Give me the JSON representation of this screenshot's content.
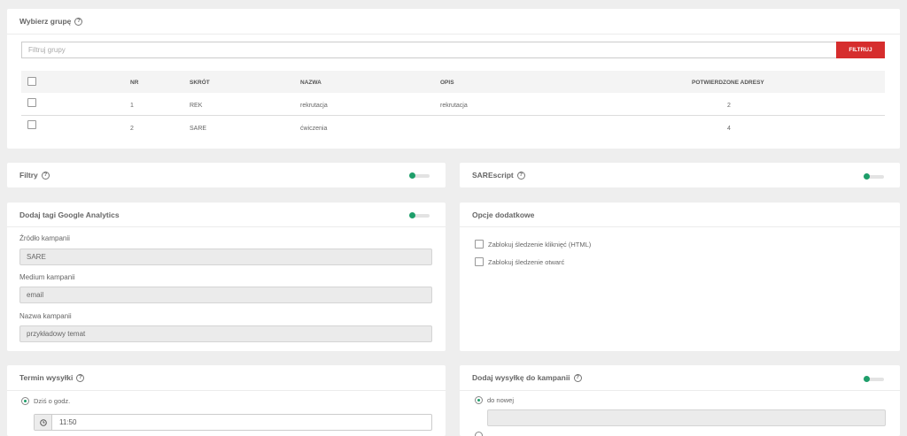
{
  "groups": {
    "title": "Wybierz grupę",
    "filter_placeholder": "Filtruj grupy",
    "filter_button": "FILTRUJ",
    "columns": [
      "NR",
      "SKRÓT",
      "NAZWA",
      "OPIS",
      "POTWIERDZONE ADRESY"
    ],
    "rows": [
      {
        "nr": "1",
        "skrot": "REK",
        "nazwa": "rekrutacja",
        "opis": "rekrutacja",
        "adresy": "2"
      },
      {
        "nr": "2",
        "skrot": "SARE",
        "nazwa": "ćwiczenia",
        "opis": "",
        "adresy": "4"
      }
    ]
  },
  "filters": {
    "title": "Filtry"
  },
  "sarescript": {
    "title": "SAREscript"
  },
  "ga": {
    "title": "Dodaj tagi Google Analytics",
    "source_label": "Źródło kampanii",
    "source_value": "SARE",
    "medium_label": "Medium kampanii",
    "medium_value": "email",
    "name_label": "Nazwa kampanii",
    "name_value": "przykładowy temat"
  },
  "extra": {
    "title": "Opcje dodatkowe",
    "opt1": "Zablokuj śledzenie kliknięć (HTML)",
    "opt2": "Zablokuj śledzenie otwarć"
  },
  "schedule": {
    "title": "Termin wysyłki",
    "today_label": "Dziś o godz.",
    "time": "11:50"
  },
  "campaign": {
    "title": "Dodaj wysyłkę do kampanii",
    "new_label": "do nowej"
  }
}
